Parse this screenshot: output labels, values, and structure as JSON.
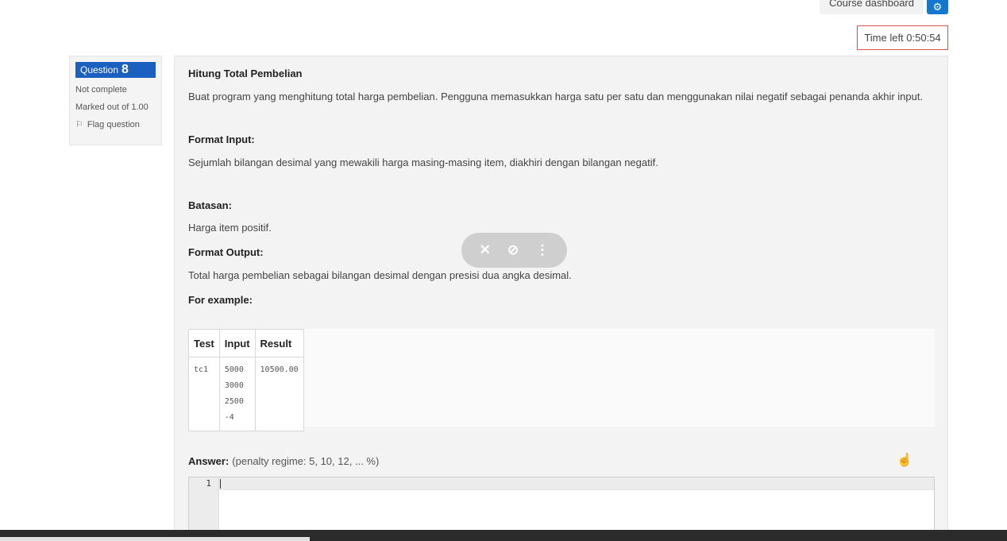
{
  "header": {
    "course_dashboard_label": "Course dashboard",
    "gear_icon": "gear-icon"
  },
  "timer": {
    "label": "Time left 0:50:54"
  },
  "question_info": {
    "question_label": "Question",
    "question_number": "8",
    "status": "Not complete",
    "marked_out_of": "Marked out of 1.00",
    "flag_label": "Flag question",
    "flag_icon": "flag-icon"
  },
  "question": {
    "title": "Hitung Total Pembelian",
    "description": "Buat program yang menghitung total harga pembelian. Pengguna memasukkan harga satu per satu dan menggunakan nilai negatif sebagai penanda akhir input.",
    "format_input_label": "Format Input:",
    "format_input_text": "Sejumlah bilangan desimal yang mewakili harga masing-masing item, diakhiri dengan bilangan negatif.",
    "batasan_label": "Batasan:",
    "batasan_text": "Harga item positif.",
    "format_output_label": "Format Output:",
    "format_output_text": "Total harga pembelian sebagai bilangan desimal dengan presisi dua angka desimal.",
    "example_label": "For example:"
  },
  "example_table": {
    "headers": [
      "Test",
      "Input",
      "Result"
    ],
    "rows": [
      {
        "test": "tc1",
        "input": [
          "5000",
          "3000",
          "2500",
          "-4"
        ],
        "result": "10500.00"
      }
    ]
  },
  "answer": {
    "label": "Answer:",
    "penalty": "(penalty regime: 5, 10, 12, ... %)",
    "line_number": "1"
  },
  "overlay": {
    "icons": [
      "pin-off-icon",
      "eye-off-icon",
      "more-vertical-icon"
    ]
  }
}
